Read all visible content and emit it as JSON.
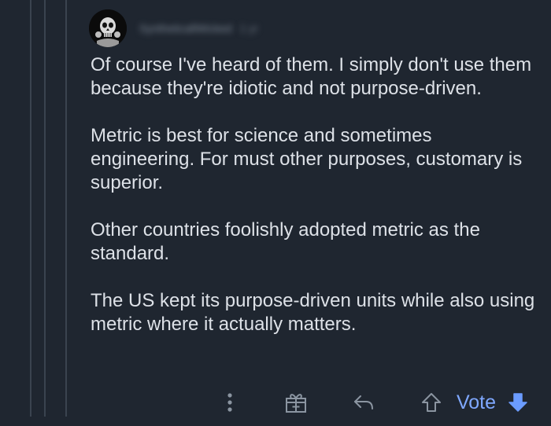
{
  "comment": {
    "author": "SyntheticallWicked",
    "timestamp": "1 yr",
    "paragraphs": [
      "Of course I've heard of them. I simply don't use them because they're idiotic and not purpose-driven.",
      "Metric is best for science and sometimes engineering. For must other purposes, customary is superior.",
      "Other countries foolishly adopted metric as the standard.",
      "The US kept its purpose-driven units while also using metric where it actually matters."
    ]
  },
  "actions": {
    "more": "more-vertical-icon",
    "award": "gift-icon",
    "reply": "reply-icon",
    "upvote": "arrow-up-outline-icon",
    "vote_label": "Vote",
    "downvote": "arrow-down-filled-icon"
  },
  "colors": {
    "background": "#1f2630",
    "text": "#dde1e7",
    "muted": "#8b95a1",
    "thread_line": "#3a434f",
    "vote_accent": "#7fa8ff",
    "downvote_accent": "#6b9cff"
  }
}
